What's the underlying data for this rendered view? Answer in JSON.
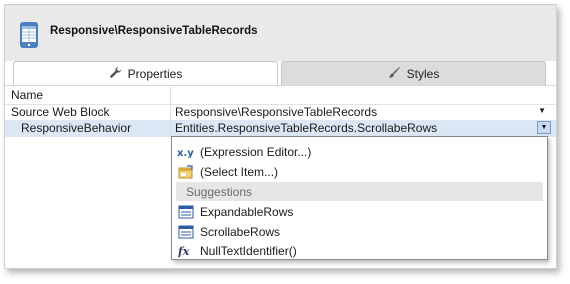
{
  "header": {
    "title": "Responsive\\ResponsiveTableRecords",
    "icon": "web-block-icon"
  },
  "tabs": [
    {
      "label": "Properties",
      "icon": "wrench-icon",
      "active": true
    },
    {
      "label": "Styles",
      "icon": "brush-icon",
      "active": false
    }
  ],
  "properties": {
    "name": {
      "label": "Name",
      "value": ""
    },
    "source_web_block": {
      "label": "Source Web Block",
      "value": "Responsive\\ResponsiveTableRecords"
    },
    "responsive_behavior": {
      "label": "ResponsiveBehavior",
      "value": "Entities.ResponsiveTableRecords.ScrollabeRows"
    }
  },
  "dropdown": {
    "items": [
      {
        "label": "(Expression Editor...)",
        "icon": "xy-expression-icon"
      },
      {
        "label": "(Select Item...)",
        "icon": "select-item-icon"
      }
    ],
    "section_label": "Suggestions",
    "suggestions": [
      {
        "label": "ExpandableRows",
        "icon": "entity-record-icon"
      },
      {
        "label": "ScrollabeRows",
        "icon": "entity-record-icon"
      },
      {
        "label": "NullTextIdentifier()",
        "icon": "function-icon"
      }
    ]
  },
  "colors": {
    "header_bg": "#e9e9e9",
    "selected_row_bg": "#dbe7f5",
    "dropdown_button_bg": "#c9d9ee",
    "section_bg": "#e6e6e6"
  }
}
